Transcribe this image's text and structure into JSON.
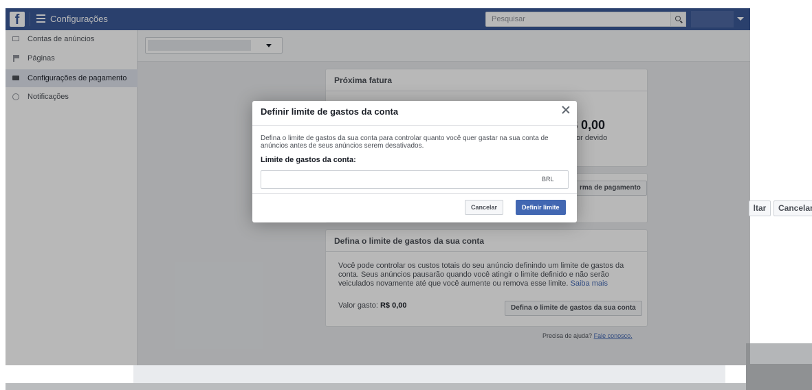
{
  "topbar": {
    "logo_glyph": "f",
    "title": "Configurações",
    "search_placeholder": "Pesquisar"
  },
  "sidebar": {
    "items": [
      {
        "label": "Contas de anúncios",
        "icon": "monitor-icon"
      },
      {
        "label": "Páginas",
        "icon": "flag-icon"
      },
      {
        "label": "Configurações de pagamento",
        "icon": "credit-card-icon"
      },
      {
        "label": "Notificações",
        "icon": "globe-icon"
      }
    ]
  },
  "next_invoice": {
    "title": "Próxima fatura",
    "amount": "$ 0,00",
    "amount_note": "or devido"
  },
  "payment": {
    "button_label": "rma de pagamento"
  },
  "spending_limit_card": {
    "title": "Defina o limite de gastos da sua conta",
    "description": "Você pode controlar os custos totais do seu anúncio definindo um limite de gastos da conta. Seus anúncios pausarão quando você atingir o limite definido e não serão veiculados novamente até que você aumente ou remova esse limite.",
    "learn_more": "Saiba mais",
    "spent_label": "Valor gasto:",
    "spent_value": "R$ 0,00",
    "button_label": "Defina o limite de gastos da sua conta"
  },
  "help": {
    "text": "Precisa de ajuda?",
    "link": "Fale conosco."
  },
  "modal": {
    "title": "Definir limite de gastos da conta",
    "description": "Defina o limite de gastos da sua conta para controlar quanto você quer gastar na sua conta de anúncios antes de seus anúncios serem desativados.",
    "field_label": "Limite de gastos da conta:",
    "input_value": "",
    "currency": "BRL",
    "cancel_label": "Cancelar",
    "confirm_label": "Definir limite"
  },
  "right_buttons": {
    "back_label": "ltar",
    "cancel_label": "Cancelar"
  },
  "colors": {
    "topbar": "#3b5998",
    "primary_button": "#4267b2",
    "page_background": "#e9ebee"
  }
}
